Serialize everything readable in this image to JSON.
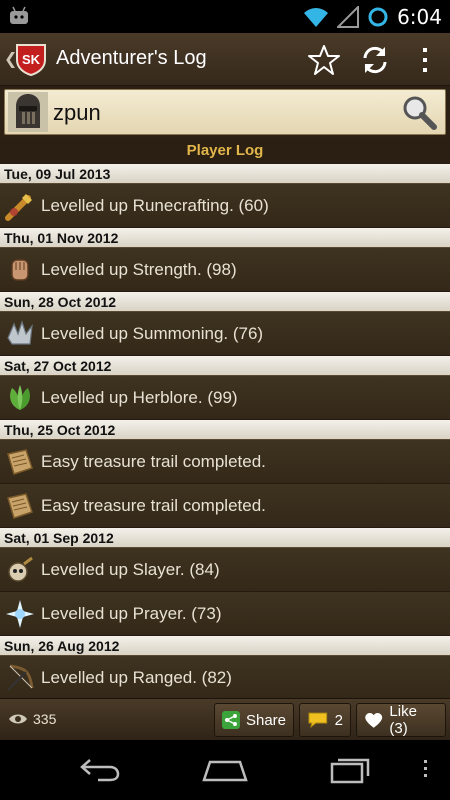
{
  "status_bar": {
    "time": "6:04"
  },
  "app_bar": {
    "logo_text": "SK",
    "title": "Adventurer's Log"
  },
  "search": {
    "value": "zpun"
  },
  "section_title": "Player Log",
  "log": [
    {
      "date": "Tue, 09 Jul 2013",
      "entries": [
        {
          "icon": "runecrafting-icon",
          "text": "Levelled up Runecrafting. (60)"
        }
      ]
    },
    {
      "date": "Thu, 01 Nov 2012",
      "entries": [
        {
          "icon": "strength-icon",
          "text": "Levelled up Strength. (98)"
        }
      ]
    },
    {
      "date": "Sun, 28 Oct 2012",
      "entries": [
        {
          "icon": "summoning-icon",
          "text": "Levelled up Summoning. (76)"
        }
      ]
    },
    {
      "date": "Sat, 27 Oct 2012",
      "entries": [
        {
          "icon": "herblore-icon",
          "text": "Levelled up Herblore. (99)"
        }
      ]
    },
    {
      "date": "Thu, 25 Oct 2012",
      "entries": [
        {
          "icon": "treasure-scroll-icon",
          "text": "Easy treasure trail completed."
        },
        {
          "icon": "treasure-scroll-icon",
          "text": "Easy treasure trail completed."
        }
      ]
    },
    {
      "date": "Sat, 01 Sep 2012",
      "entries": [
        {
          "icon": "slayer-icon",
          "text": "Levelled up Slayer. (84)"
        },
        {
          "icon": "prayer-icon",
          "text": "Levelled up Prayer. (73)"
        }
      ]
    },
    {
      "date": "Sun, 26 Aug 2012",
      "entries": [
        {
          "icon": "ranged-icon",
          "text": "Levelled up Ranged. (82)"
        }
      ]
    }
  ],
  "bottom_bar": {
    "views": "335",
    "share_label": "Share",
    "comments": "2",
    "like_label": "Like (3)"
  },
  "colors": {
    "accent": "#e2b64b",
    "bar_brown": "#4a3a28",
    "header_light": "#f4f1ea",
    "status_blue": "#33b5e5"
  }
}
